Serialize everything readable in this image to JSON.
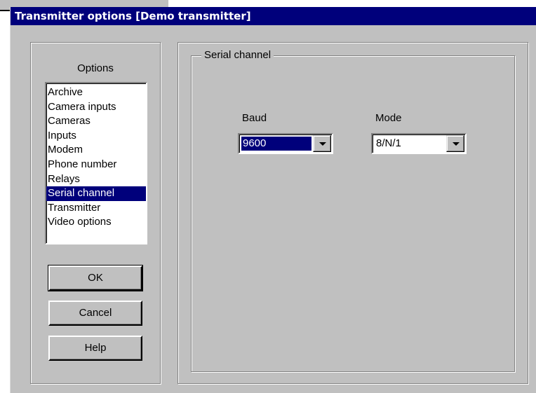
{
  "window": {
    "title": "Transmitter options [Demo transmitter]"
  },
  "options": {
    "label": "Options",
    "items": [
      {
        "label": "Archive",
        "selected": false
      },
      {
        "label": "Camera inputs",
        "selected": false
      },
      {
        "label": "Cameras",
        "selected": false
      },
      {
        "label": "Inputs",
        "selected": false
      },
      {
        "label": "Modem",
        "selected": false
      },
      {
        "label": "Phone number",
        "selected": false
      },
      {
        "label": "Relays",
        "selected": false
      },
      {
        "label": "Serial channel",
        "selected": true
      },
      {
        "label": "Transmitter",
        "selected": false
      },
      {
        "label": "Video options",
        "selected": false
      }
    ]
  },
  "buttons": {
    "ok": "OK",
    "cancel": "Cancel",
    "help": "Help"
  },
  "serial_channel": {
    "group_title": "Serial channel",
    "baud": {
      "label": "Baud",
      "value": "9600"
    },
    "mode": {
      "label": "Mode",
      "value": "8/N/1"
    }
  },
  "colors": {
    "titlebar": "#00007b",
    "dialog_face": "#c0c0c0",
    "selection": "#00007b"
  },
  "icons": {
    "dropdown": "chevron-down-icon"
  }
}
